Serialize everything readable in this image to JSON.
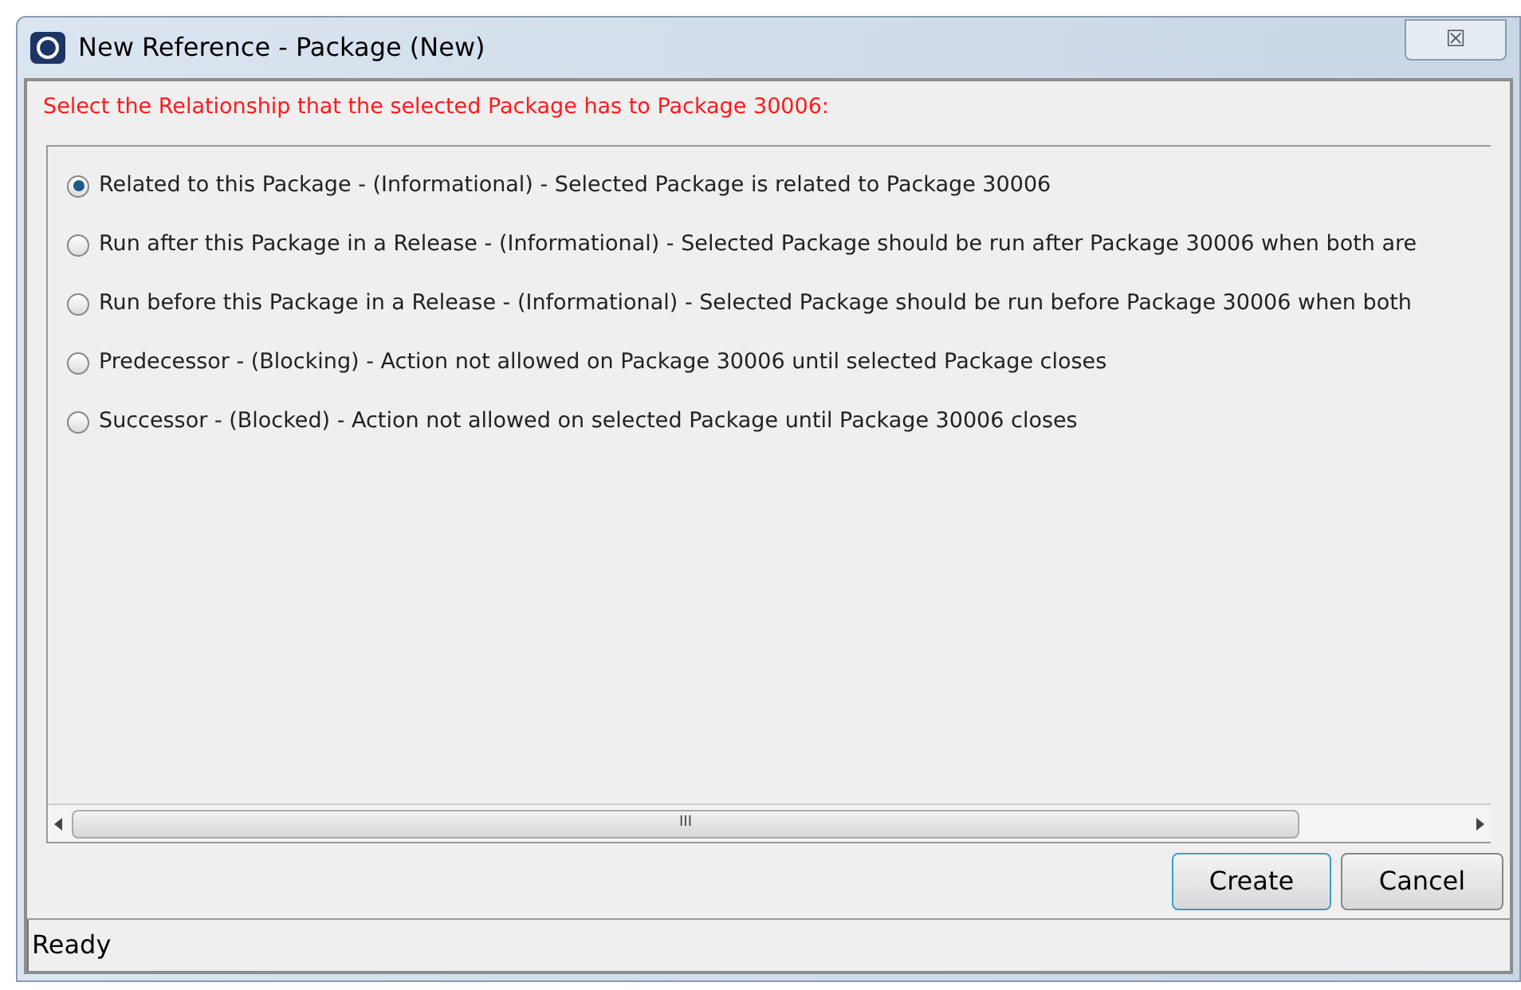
{
  "window": {
    "title": "New Reference - Package (New)",
    "close": "☒"
  },
  "prompt": "Select the Relationship that the selected Package has to Package 30006:",
  "options": [
    {
      "label": "Related to this Package - (Informational) - Selected Package is related to Package 30006",
      "selected": true
    },
    {
      "label": "Run after this Package in a Release - (Informational) - Selected Package should be run after Package 30006 when both are",
      "selected": false
    },
    {
      "label": "Run before this Package in a Release - (Informational) - Selected Package should be run before Package 30006 when both",
      "selected": false
    },
    {
      "label": "Predecessor - (Blocking) - Action not allowed on Package 30006 until selected Package closes",
      "selected": false
    },
    {
      "label": "Successor - (Blocked) - Action not allowed on selected Package until Package 30006 closes",
      "selected": false
    }
  ],
  "scrollbar": {
    "grip": "III"
  },
  "buttons": [
    {
      "label": "Create",
      "kind": "default"
    },
    {
      "label": "Cancel",
      "kind": "normal"
    }
  ],
  "status_bar": "Ready"
}
